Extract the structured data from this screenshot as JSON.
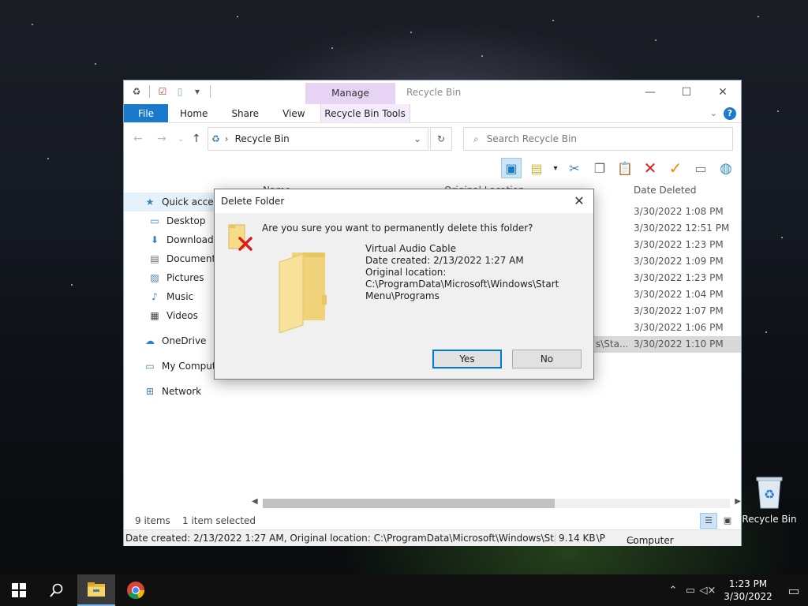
{
  "explorer": {
    "title": "Recycle Bin",
    "manage_tab": "Manage",
    "ribbon_tabs": {
      "file": "File",
      "home": "Home",
      "share": "Share",
      "view": "View",
      "tools": "Recycle Bin Tools"
    },
    "address": "Recycle Bin",
    "search_placeholder": "Search Recycle Bin",
    "columns": {
      "name": "Name",
      "original_location": "Original Location",
      "date_deleted": "Date Deleted"
    },
    "nav": {
      "quick_access": "Quick access",
      "desktop": "Desktop",
      "downloads": "Downloads",
      "documents": "Documents",
      "pictures": "Pictures",
      "music": "Music",
      "videos": "Videos",
      "onedrive": "OneDrive",
      "my_computer": "My Compute",
      "network": "Network"
    },
    "dates": [
      "3/30/2022 1:08 PM",
      "3/30/2022 12:51 PM",
      "3/30/2022 1:23 PM",
      "3/30/2022 1:09 PM",
      "3/30/2022 1:23 PM",
      "3/30/2022 1:04 PM",
      "3/30/2022 1:07 PM",
      "3/30/2022 1:06 PM",
      "3/30/2022 1:10 PM"
    ],
    "selected_location_partial": "s\\Sta...",
    "status": {
      "items": "9 items",
      "selected": "1 item selected"
    },
    "details_bar": {
      "text": "Date created: 2/13/2022 1:27 AM, Original location: C:\\ProgramData\\Microsoft\\Windows\\Start Menu\\P",
      "size": "9.14 KB",
      "computer": "Computer"
    }
  },
  "dialog": {
    "title": "Delete Folder",
    "question": "Are you sure you want to permanently delete this folder?",
    "item_name": "Virtual Audio Cable",
    "date_created": "Date created: 2/13/2022 1:27 AM",
    "original_location_label": "Original location:",
    "original_location_line1": "C:\\ProgramData\\Microsoft\\Windows\\Start",
    "original_location_line2": "Menu\\Programs",
    "yes": "Yes",
    "no": "No"
  },
  "desktop": {
    "recycle_bin_label": "Recycle Bin"
  },
  "taskbar": {
    "time": "1:23 PM",
    "date": "3/30/2022"
  },
  "colors": {
    "accent": "#1979ca",
    "manage_tab": "#e7d4f5",
    "dialog_primary_border": "#0078d7",
    "delete_red": "#d81e1e",
    "restore_orange": "#f08a00"
  }
}
